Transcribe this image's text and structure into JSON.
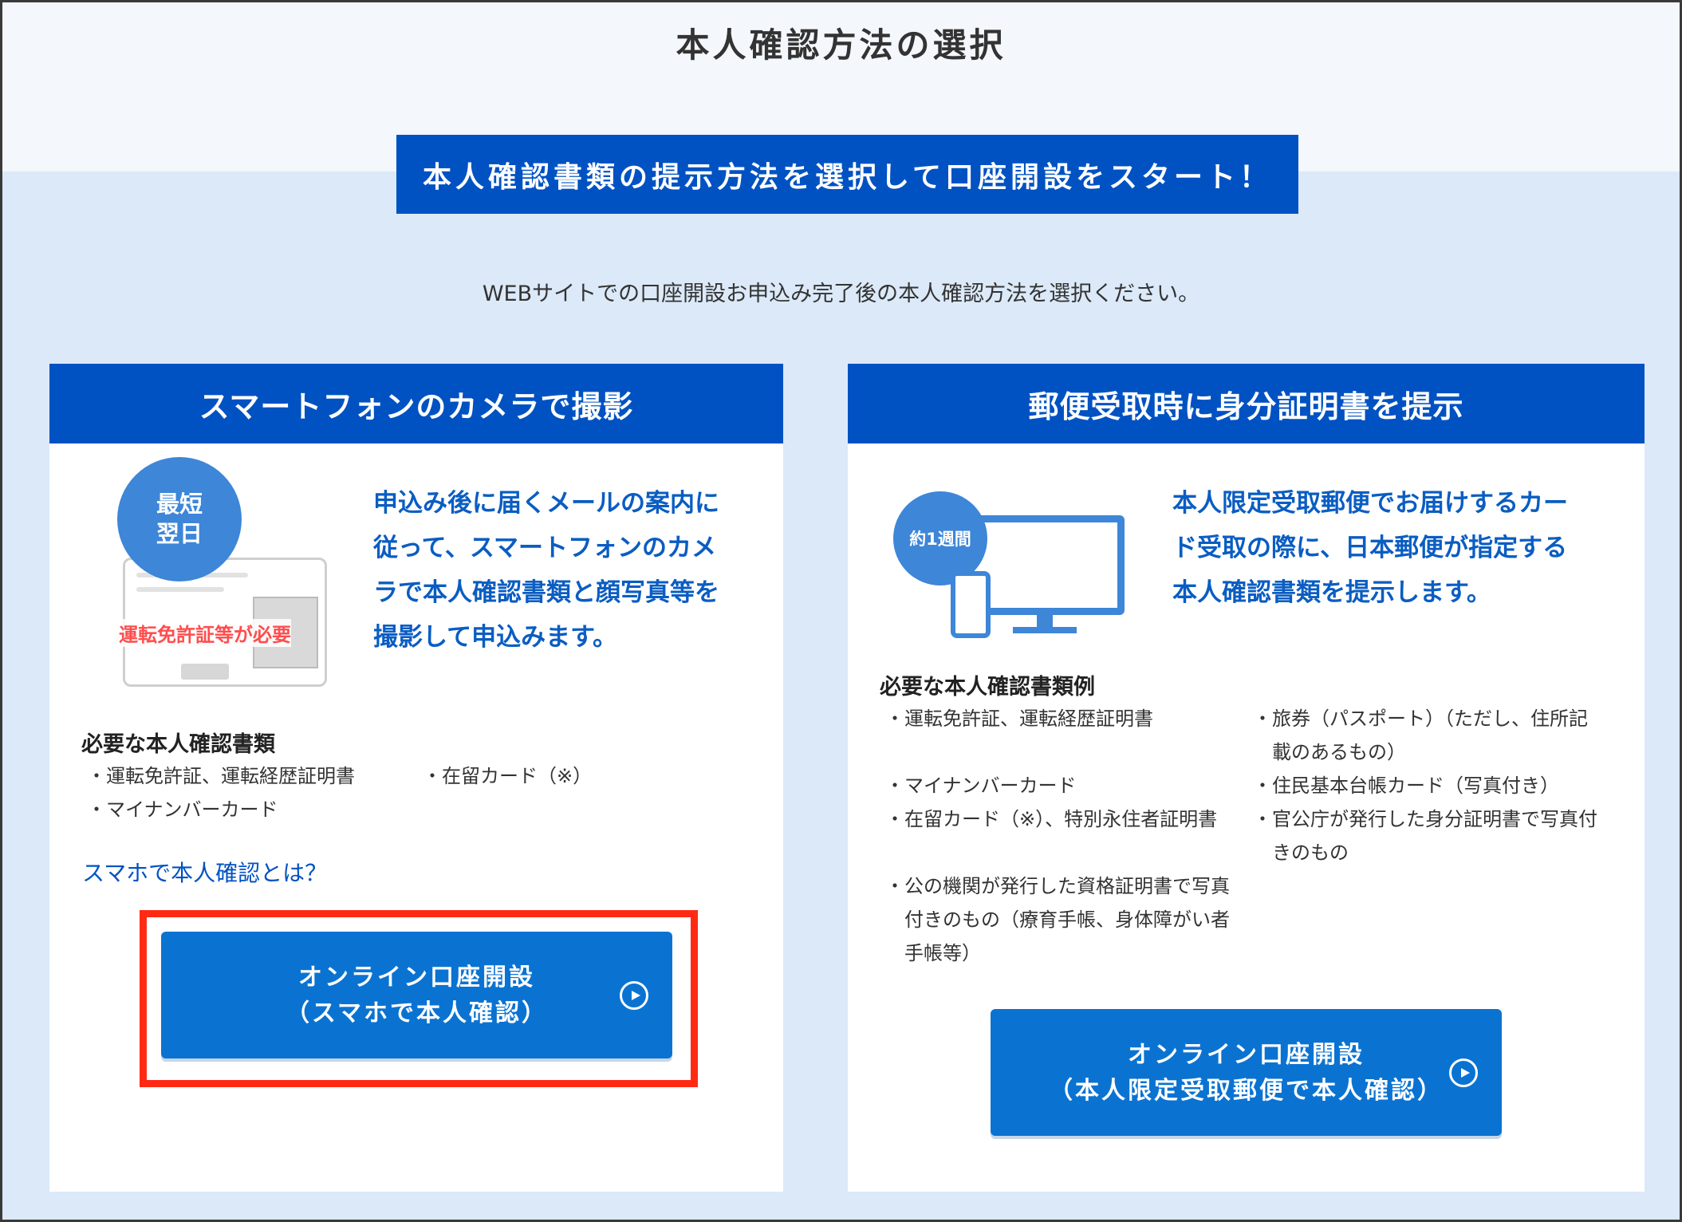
{
  "page": {
    "title": "本人確認方法の選択",
    "start_banner": "本人確認書類の提示方法を選択して口座開設をスタート！",
    "instruction": "WEBサイトでの口座開設お申込み完了後の本人確認方法を選択ください。"
  },
  "left": {
    "header": "スマートフォンのカメラで撮影",
    "badge_line1": "最短",
    "badge_line2": "翌日",
    "license_note": "運転免許証等が必要",
    "lead_lines": [
      "申込み後に届くメールの案内に",
      "従って、スマートフォンのカメ",
      "ラで本人確認書類と顔写真等を",
      "撮影して申込みます。"
    ],
    "docs_label": "必要な本人確認書類",
    "docs": [
      "運転免許証、運転経歴証明書",
      "マイナンバーカード",
      "在留カード（※）"
    ],
    "link": "スマホで本人確認とは？",
    "button_line1": "オンライン口座開設",
    "button_line2": "（スマホで本人確認）"
  },
  "right": {
    "header": "郵便受取時に身分証明書を提示",
    "badge": "約1週間",
    "lead_lines": [
      "本人限定受取郵便でお届けするカー",
      "ド受取の際に、日本郵便が指定する",
      "本人確認書類を提示します。"
    ],
    "docs_label": "必要な本人確認書類例",
    "docs_col1": [
      "運転免許証、運転経歴証明書",
      "マイナンバーカード",
      "在留カード（※）、特別永住者証明書",
      "公の機関が発行した資格証明書で写真付きのもの（療育手帳、身体障がい者手帳等）"
    ],
    "docs_col2": [
      "旅券（パスポート）（ただし、住所記載のあるもの）",
      "住民基本台帳カード（写真付き）",
      "官公庁が発行した身分証明書で写真付きのもの"
    ],
    "button_line1": "オンライン口座開設",
    "button_line2": "（本人限定受取郵便で本人確認）"
  },
  "colors": {
    "primary": "#0052c3",
    "button": "#0a73d2",
    "lead_text": "#0a5dc2",
    "highlight": "#ff2a13",
    "background": "#dbe9f8"
  }
}
